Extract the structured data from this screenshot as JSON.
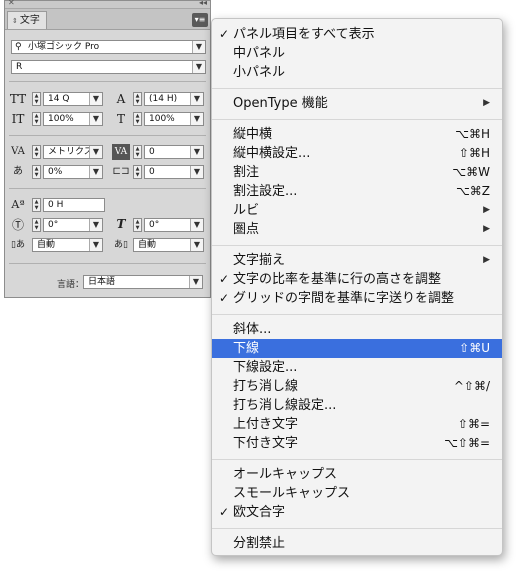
{
  "panel": {
    "tab_label": "文字",
    "font_family": "小塚ゴシック Pro",
    "font_style": "R",
    "font_size": "14 Q",
    "leading": "(14 H)",
    "vertical_scale": "100%",
    "horizontal_scale": "100%",
    "kerning": "メトリクス",
    "tracking": "0",
    "tsume": "0%",
    "aki": "0",
    "baseline_shift": "0 H",
    "rotation": "0°",
    "skew": "0°",
    "mojiaki_left": "自動",
    "mojiaki_right": "自動",
    "language_label": "言語：",
    "language": "日本語"
  },
  "menu": {
    "items": [
      {
        "label": "パネル項目をすべて表示",
        "checked": true,
        "shortcut": "",
        "submenu": false,
        "highlighted": false
      },
      {
        "label": "中パネル",
        "checked": false,
        "shortcut": "",
        "submenu": false,
        "highlighted": false
      },
      {
        "label": "小パネル",
        "checked": false,
        "shortcut": "",
        "submenu": false,
        "highlighted": false
      },
      {
        "label": "OpenType 機能",
        "checked": false,
        "shortcut": "",
        "submenu": true,
        "highlighted": false
      },
      {
        "label": "縦中横",
        "checked": false,
        "shortcut": "⌥⌘H",
        "submenu": false,
        "highlighted": false
      },
      {
        "label": "縦中横設定...",
        "checked": false,
        "shortcut": "⇧⌘H",
        "submenu": false,
        "highlighted": false
      },
      {
        "label": "割注",
        "checked": false,
        "shortcut": "⌥⌘W",
        "submenu": false,
        "highlighted": false
      },
      {
        "label": "割注設定...",
        "checked": false,
        "shortcut": "⌥⌘Z",
        "submenu": false,
        "highlighted": false
      },
      {
        "label": "ルビ",
        "checked": false,
        "shortcut": "",
        "submenu": true,
        "highlighted": false
      },
      {
        "label": "圏点",
        "checked": false,
        "shortcut": "",
        "submenu": true,
        "highlighted": false
      },
      {
        "label": "文字揃え",
        "checked": false,
        "shortcut": "",
        "submenu": true,
        "highlighted": false
      },
      {
        "label": "文字の比率を基準に行の高さを調整",
        "checked": true,
        "shortcut": "",
        "submenu": false,
        "highlighted": false
      },
      {
        "label": "グリッドの字間を基準に字送りを調整",
        "checked": true,
        "shortcut": "",
        "submenu": false,
        "highlighted": false
      },
      {
        "label": "斜体...",
        "checked": false,
        "shortcut": "",
        "submenu": false,
        "highlighted": false
      },
      {
        "label": "下線",
        "checked": false,
        "shortcut": "⇧⌘U",
        "submenu": false,
        "highlighted": true
      },
      {
        "label": "下線設定...",
        "checked": false,
        "shortcut": "",
        "submenu": false,
        "highlighted": false
      },
      {
        "label": "打ち消し線",
        "checked": false,
        "shortcut": "^⇧⌘/",
        "submenu": false,
        "highlighted": false
      },
      {
        "label": "打ち消し線設定...",
        "checked": false,
        "shortcut": "",
        "submenu": false,
        "highlighted": false
      },
      {
        "label": "上付き文字",
        "checked": false,
        "shortcut": "⇧⌘=",
        "submenu": false,
        "highlighted": false
      },
      {
        "label": "下付き文字",
        "checked": false,
        "shortcut": "⌥⇧⌘=",
        "submenu": false,
        "highlighted": false
      },
      {
        "label": "オールキャップス",
        "checked": false,
        "shortcut": "",
        "submenu": false,
        "highlighted": false
      },
      {
        "label": "スモールキャップス",
        "checked": false,
        "shortcut": "",
        "submenu": false,
        "highlighted": false
      },
      {
        "label": "欧文合字",
        "checked": true,
        "shortcut": "",
        "submenu": false,
        "highlighted": false
      },
      {
        "label": "分割禁止",
        "checked": false,
        "shortcut": "",
        "submenu": false,
        "highlighted": false
      }
    ]
  },
  "colors": {
    "highlight": "#3a6fde",
    "panel_bg": "#d7d7d7",
    "menu_bg": "#f3f3f3"
  }
}
